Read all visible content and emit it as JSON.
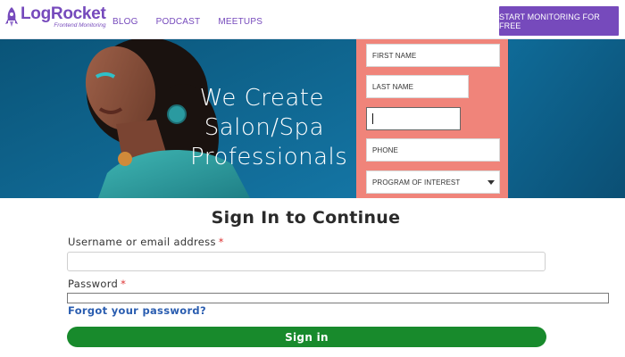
{
  "header": {
    "logo_name": "LogRocket",
    "logo_tagline": "Frontend Monitoring",
    "nav": [
      "BLOG",
      "PODCAST",
      "MEETUPS"
    ],
    "cta_label": "START MONITORING FOR FREE",
    "brand_color": "#764abc"
  },
  "hero": {
    "headline_lines": [
      "We Create",
      "Salon/Spa",
      "Professionals"
    ],
    "background_color": "#0f5f88",
    "form_panel_color": "#f0847a",
    "form": {
      "first_name_placeholder": "FIRST NAME",
      "last_name_placeholder": "LAST NAME",
      "email_value": "",
      "phone_placeholder": "PHONE",
      "program_placeholder": "PROGRAM OF INTEREST"
    }
  },
  "signin": {
    "title": "Sign In to Continue",
    "username_label": "Username or email address",
    "password_label": "Password",
    "required_mark": "*",
    "forgot_link": "Forgot your password?",
    "submit_label": "Sign in",
    "button_color": "#188a2c"
  },
  "icons": {
    "logo": "rocket-icon",
    "dropdown": "chevron-down-icon"
  }
}
